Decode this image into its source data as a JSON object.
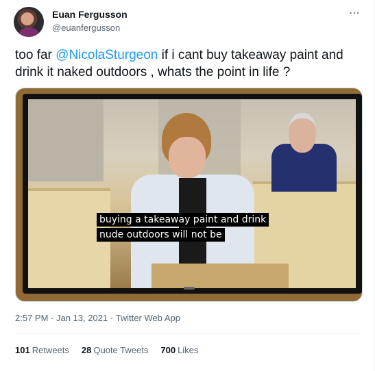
{
  "author": {
    "name": "Euan Fergusson",
    "handle": "@euanfergusson"
  },
  "more_icon": "⋯",
  "tweet": {
    "prefix": "too far ",
    "mention": "@NicolaSturgeon",
    "body": " if i cant buy takeaway paint and drink it naked outdoors , whats the point in life ?"
  },
  "media": {
    "caption_line1": "buying a takeaway paint and drink",
    "caption_line2": "nude outdoors will not be"
  },
  "meta": {
    "time": "2:57 PM",
    "date": "Jan 13, 2021",
    "source": "Twitter Web App",
    "separator": "·"
  },
  "stats": {
    "retweets_count": "101",
    "retweets_label": "Retweets",
    "quotes_count": "28",
    "quotes_label": "Quote Tweets",
    "likes_count": "700",
    "likes_label": "Likes"
  },
  "colors": {
    "link": "#1d9bf0",
    "text": "#0f1419",
    "secondary": "#536471"
  }
}
